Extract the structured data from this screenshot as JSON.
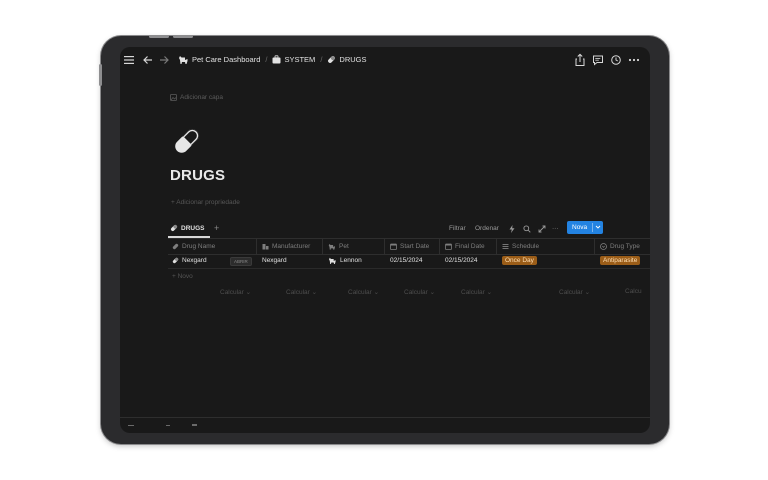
{
  "topbar": {
    "breadcrumbs": [
      {
        "label": "Pet Care Dashboard",
        "icon": "dog-icon"
      },
      {
        "label": "SYSTEM",
        "icon": "briefcase-icon"
      },
      {
        "label": "DRUGS",
        "icon": "pill-icon"
      }
    ],
    "separator": "/"
  },
  "page": {
    "cover_label": "Adicionar capa",
    "title": "DRUGS",
    "add_property": "+  Adicionar propriedade"
  },
  "database": {
    "view_tab": "DRUGS",
    "add_view": "+",
    "filter_label": "Filtrar",
    "sort_label": "Ordenar",
    "more_label": "···",
    "new_label": "Nova",
    "columns": [
      "Drug Name",
      "Manufacturer",
      "Pet",
      "Start Date",
      "Final Date",
      "Schedule",
      "Drug Type"
    ],
    "rows": [
      {
        "drug_name": "Nexgard",
        "open_label": "ABRIR",
        "manufacturer": "Nexgard",
        "pet": "Lennon",
        "start_date": "02/15/2024",
        "final_date": "02/15/2024",
        "schedule": "Once Day",
        "drug_type": "Antiparasite"
      }
    ],
    "new_row_label": "+  Novo",
    "calculate_labels": [
      "Calcular ⌄",
      "Calcular ⌄",
      "Calcular ⌄",
      "Calcular ⌄",
      "Calcular ⌄",
      "Calcular ⌄",
      "Calcu"
    ]
  },
  "colors": {
    "background": "#191919",
    "accent": "#2383e2",
    "tag_orange": "#9b5d18",
    "tag_text": "#ffdfb4"
  }
}
